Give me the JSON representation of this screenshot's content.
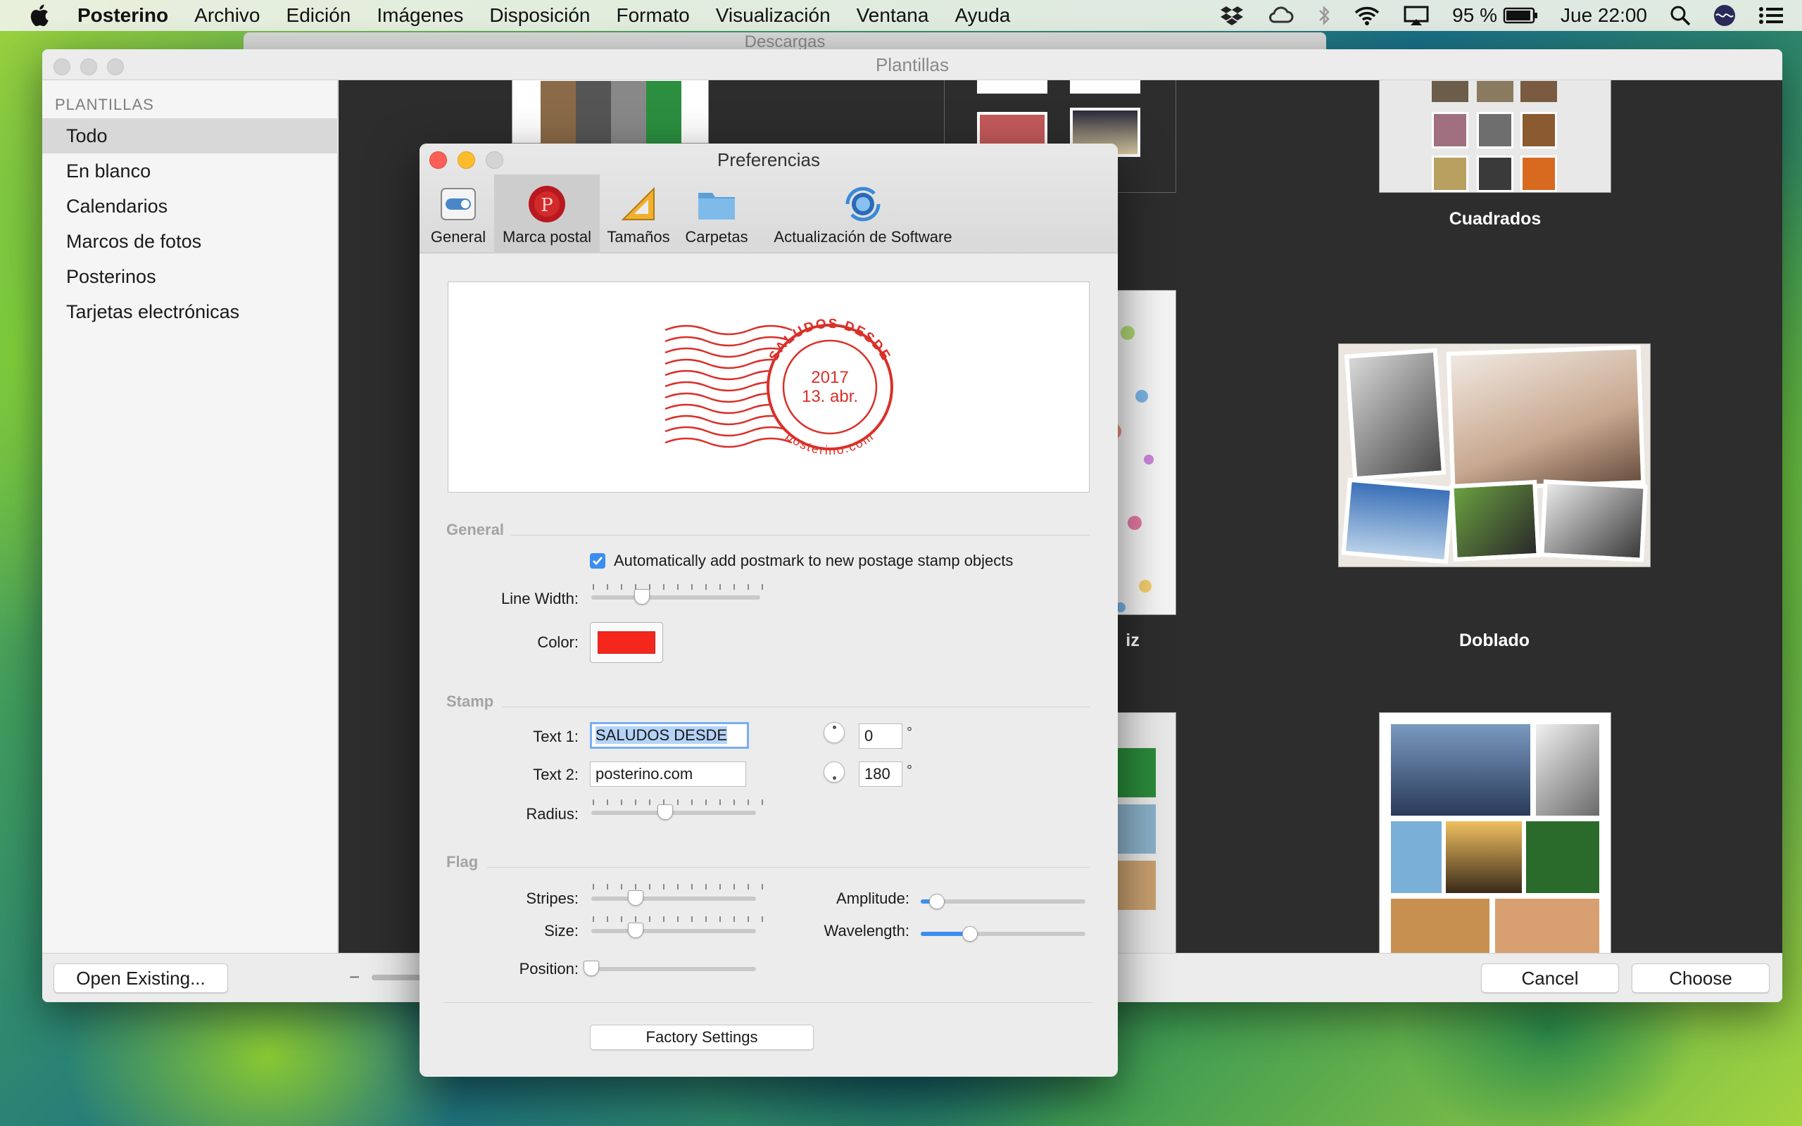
{
  "menubar": {
    "app_name": "Posterino",
    "items": [
      "Archivo",
      "Edición",
      "Imágenes",
      "Disposición",
      "Formato",
      "Visualización",
      "Ventana",
      "Ayuda"
    ],
    "battery": "95 %",
    "clock": "Jue 22:00"
  },
  "back_window": {
    "title": "Descargas"
  },
  "main_window": {
    "title": "Plantillas",
    "sidebar": {
      "heading": "PLANTILLAS",
      "items": [
        "Todo",
        "En blanco",
        "Calendarios",
        "Marcos de fotos",
        "Posterinos",
        "Tarjetas electrónicas"
      ],
      "selected": "Todo"
    },
    "templates": {
      "label_cuadrados": "Cuadrados",
      "label_doblado": "Doblado",
      "label_partial": "iz"
    },
    "buttons": {
      "open_existing": "Open Existing...",
      "cancel": "Cancel",
      "choose": "Choose"
    },
    "zoom_minus": "−"
  },
  "preferences": {
    "title": "Preferencias",
    "tabs": [
      {
        "label": "General",
        "icon": "switch-icon"
      },
      {
        "label": "Marca postal",
        "icon": "wax-seal-icon"
      },
      {
        "label": "Tamaños",
        "icon": "ruler-triangle-icon"
      },
      {
        "label": "Carpetas",
        "icon": "folder-icon"
      },
      {
        "label": "Actualización de Software",
        "icon": "globe-sync-icon"
      }
    ],
    "selected_tab": "Marca postal",
    "postmark_preview": {
      "ring_top": "SALUDOS DESDE",
      "ring_bottom": "posterino.com",
      "year": "2017",
      "date": "13. abr.",
      "color": "#d9302a"
    },
    "general": {
      "heading": "General",
      "auto_add_label": "Automatically add postmark to new postage stamp objects",
      "auto_add_checked": true,
      "line_width_label": "Line Width:",
      "line_width_value": 0.3,
      "color_label": "Color:",
      "color_value": "#f5271c"
    },
    "stamp": {
      "heading": "Stamp",
      "text1_label": "Text 1:",
      "text1_value": "SALUDOS DESDE",
      "text1_angle": "0",
      "text2_label": "Text 2:",
      "text2_value": "posterino.com",
      "text2_angle": "180",
      "degree_symbol": "°",
      "radius_label": "Radius:",
      "radius_value": 0.45
    },
    "flag": {
      "heading": "Flag",
      "stripes_label": "Stripes:",
      "stripes_value": 0.27,
      "size_label": "Size:",
      "size_value": 0.27,
      "position_label": "Position:",
      "position_value": 0.0,
      "amplitude_label": "Amplitude:",
      "amplitude_value": 0.1,
      "wavelength_label": "Wavelength:",
      "wavelength_value": 0.3
    },
    "factory_button": "Factory Settings"
  },
  "colors": {
    "accent_blue": "#3b8ef0",
    "postmark_red": "#d9302a",
    "close": "#fc5f57",
    "minimize": "#fdbc2e"
  }
}
